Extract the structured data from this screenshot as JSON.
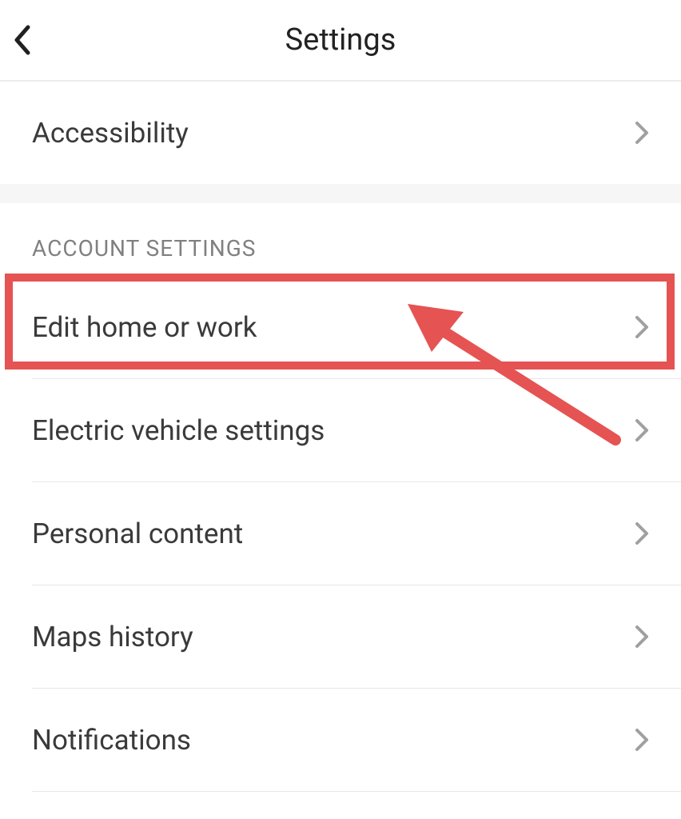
{
  "header": {
    "title": "Settings"
  },
  "top_group": {
    "items": [
      {
        "label": "Accessibility"
      }
    ]
  },
  "account_section": {
    "heading": "ACCOUNT SETTINGS",
    "items": [
      {
        "label": "Edit home or work"
      },
      {
        "label": "Electric vehicle settings"
      },
      {
        "label": "Personal content"
      },
      {
        "label": "Maps history"
      },
      {
        "label": "Notifications"
      }
    ]
  }
}
